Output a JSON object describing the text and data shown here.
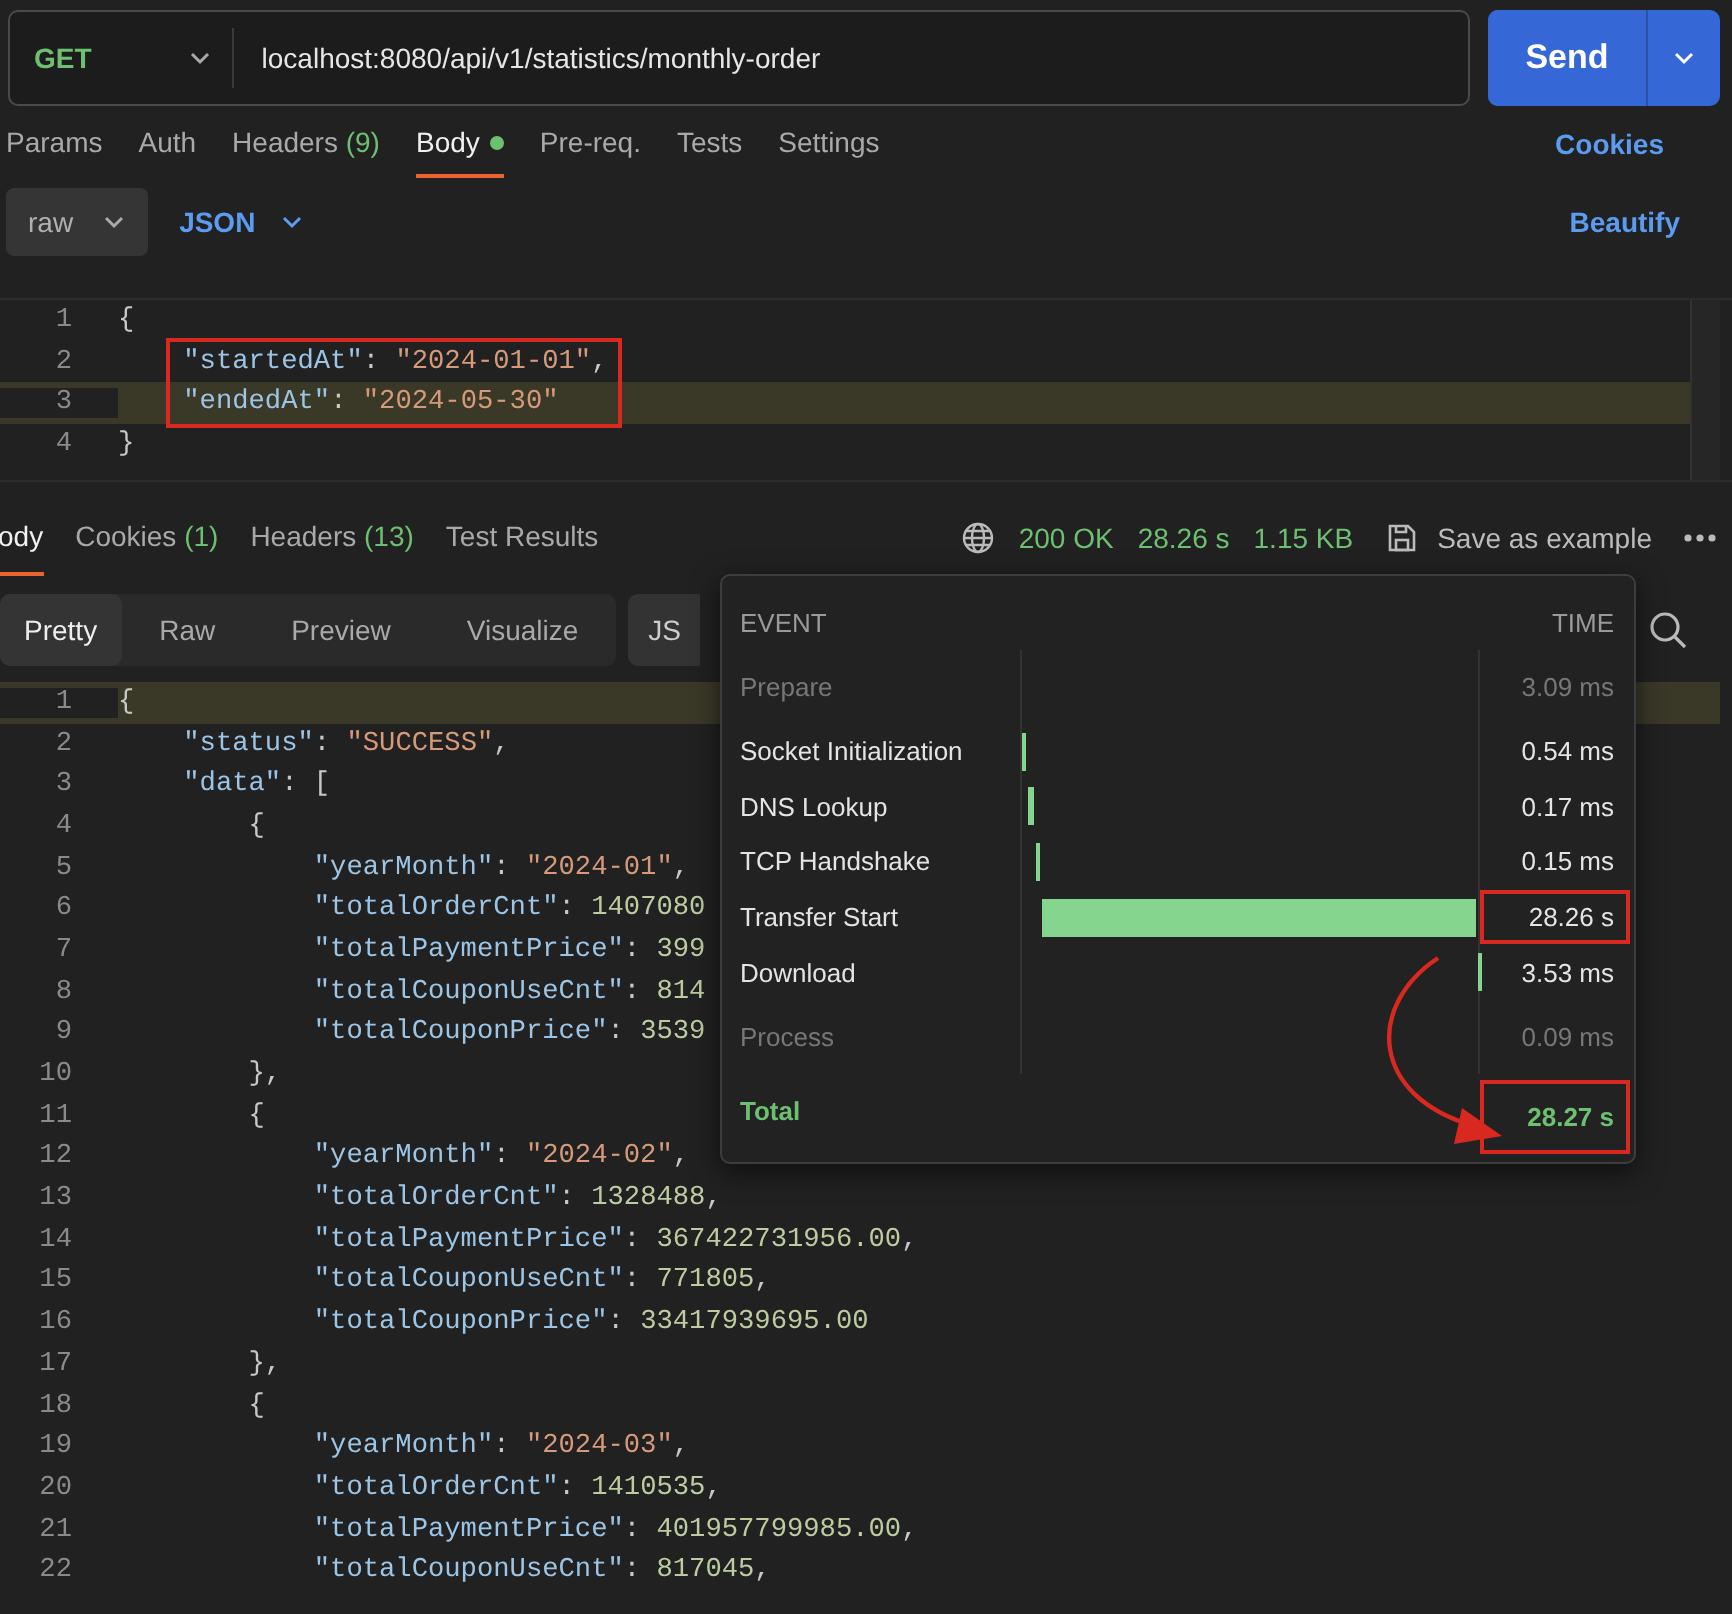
{
  "request": {
    "method": "GET",
    "url": "localhost:8080/api/v1/statistics/monthly-order",
    "send_label": "Send"
  },
  "request_tabs": [
    {
      "label": "Params",
      "selected": false
    },
    {
      "label": "Auth",
      "selected": false
    },
    {
      "label": "Headers",
      "count": "(9)",
      "selected": false
    },
    {
      "label": "Body",
      "selected": true,
      "dot": true
    },
    {
      "label": "Pre-req.",
      "selected": false
    },
    {
      "label": "Tests",
      "selected": false
    },
    {
      "label": "Settings",
      "selected": false
    }
  ],
  "cookies_link": "Cookies",
  "body_mode": {
    "type": "raw",
    "language": "JSON"
  },
  "beautify_link": "Beautify",
  "request_body": [
    {
      "number": "1",
      "current": false,
      "boxed": false,
      "tokens": [
        {
          "kind": "punct",
          "text": "{"
        }
      ]
    },
    {
      "number": "2",
      "current": false,
      "boxed": true,
      "tokens": [
        {
          "kind": "key",
          "text": "    \"startedAt\""
        },
        {
          "kind": "punct",
          "text": ": "
        },
        {
          "kind": "string",
          "text": "\"2024-01-01\""
        },
        {
          "kind": "punct",
          "text": ","
        }
      ]
    },
    {
      "number": "3",
      "current": true,
      "boxed": true,
      "tokens": [
        {
          "kind": "key",
          "text": "    \"endedAt\""
        },
        {
          "kind": "punct",
          "text": ": "
        },
        {
          "kind": "string",
          "text": "\"2024-05-30\""
        }
      ]
    },
    {
      "number": "4",
      "current": false,
      "boxed": false,
      "tokens": [
        {
          "kind": "punct",
          "text": "}"
        }
      ]
    }
  ],
  "response_tabs": [
    {
      "label": "ody",
      "selected": true
    },
    {
      "label": "Cookies",
      "count": "(1)",
      "selected": false
    },
    {
      "label": "Headers",
      "count": "(13)",
      "selected": false
    },
    {
      "label": "Test Results",
      "selected": false
    }
  ],
  "response_status": {
    "status": "200 OK",
    "time": "28.26 s",
    "size": "1.15 KB",
    "save_label": "Save as example"
  },
  "view_modes": [
    {
      "label": "Pretty",
      "selected": true
    },
    {
      "label": "Raw",
      "selected": false
    },
    {
      "label": "Preview",
      "selected": false
    },
    {
      "label": "Visualize",
      "selected": false
    }
  ],
  "format": "JS",
  "response_body": [
    {
      "number": "1",
      "current": true,
      "tokens": [
        {
          "kind": "punct",
          "text": "{"
        }
      ]
    },
    {
      "number": "2",
      "current": false,
      "tokens": [
        {
          "kind": "key",
          "text": "    \"status\""
        },
        {
          "kind": "punct",
          "text": ": "
        },
        {
          "kind": "string",
          "text": "\"SUCCESS\""
        },
        {
          "kind": "punct",
          "text": ","
        }
      ]
    },
    {
      "number": "3",
      "current": false,
      "tokens": [
        {
          "kind": "key",
          "text": "    \"data\""
        },
        {
          "kind": "punct",
          "text": ": ["
        }
      ]
    },
    {
      "number": "4",
      "current": false,
      "tokens": [
        {
          "kind": "punct",
          "text": "        {"
        }
      ]
    },
    {
      "number": "5",
      "current": false,
      "tokens": [
        {
          "kind": "key",
          "text": "            \"yearMonth\""
        },
        {
          "kind": "punct",
          "text": ": "
        },
        {
          "kind": "string",
          "text": "\"2024-01\""
        },
        {
          "kind": "punct",
          "text": ","
        }
      ]
    },
    {
      "number": "6",
      "current": false,
      "tokens": [
        {
          "kind": "key",
          "text": "            \"totalOrderCnt\""
        },
        {
          "kind": "punct",
          "text": ": "
        },
        {
          "kind": "number",
          "text": "1407080"
        }
      ]
    },
    {
      "number": "7",
      "current": false,
      "tokens": [
        {
          "kind": "key",
          "text": "            \"totalPaymentPrice\""
        },
        {
          "kind": "punct",
          "text": ": "
        },
        {
          "kind": "number",
          "text": "399"
        }
      ]
    },
    {
      "number": "8",
      "current": false,
      "tokens": [
        {
          "kind": "key",
          "text": "            \"totalCouponUseCnt\""
        },
        {
          "kind": "punct",
          "text": ": "
        },
        {
          "kind": "number",
          "text": "814"
        }
      ]
    },
    {
      "number": "9",
      "current": false,
      "tokens": [
        {
          "kind": "key",
          "text": "            \"totalCouponPrice\""
        },
        {
          "kind": "punct",
          "text": ": "
        },
        {
          "kind": "number",
          "text": "3539"
        }
      ]
    },
    {
      "number": "10",
      "current": false,
      "tokens": [
        {
          "kind": "punct",
          "text": "        },"
        }
      ]
    },
    {
      "number": "11",
      "current": false,
      "tokens": [
        {
          "kind": "punct",
          "text": "        {"
        }
      ]
    },
    {
      "number": "12",
      "current": false,
      "tokens": [
        {
          "kind": "key",
          "text": "            \"yearMonth\""
        },
        {
          "kind": "punct",
          "text": ": "
        },
        {
          "kind": "string",
          "text": "\"2024-02\""
        },
        {
          "kind": "punct",
          "text": ","
        }
      ]
    },
    {
      "number": "13",
      "current": false,
      "tokens": [
        {
          "kind": "key",
          "text": "            \"totalOrderCnt\""
        },
        {
          "kind": "punct",
          "text": ": "
        },
        {
          "kind": "number",
          "text": "1328488"
        },
        {
          "kind": "punct",
          "text": ","
        }
      ]
    },
    {
      "number": "14",
      "current": false,
      "tokens": [
        {
          "kind": "key",
          "text": "            \"totalPaymentPrice\""
        },
        {
          "kind": "punct",
          "text": ": "
        },
        {
          "kind": "number",
          "text": "367422731956.00"
        },
        {
          "kind": "punct",
          "text": ","
        }
      ]
    },
    {
      "number": "15",
      "current": false,
      "tokens": [
        {
          "kind": "key",
          "text": "            \"totalCouponUseCnt\""
        },
        {
          "kind": "punct",
          "text": ": "
        },
        {
          "kind": "number",
          "text": "771805"
        },
        {
          "kind": "punct",
          "text": ","
        }
      ]
    },
    {
      "number": "16",
      "current": false,
      "tokens": [
        {
          "kind": "key",
          "text": "            \"totalCouponPrice\""
        },
        {
          "kind": "punct",
          "text": ": "
        },
        {
          "kind": "number",
          "text": "33417939695.00"
        }
      ]
    },
    {
      "number": "17",
      "current": false,
      "tokens": [
        {
          "kind": "punct",
          "text": "        },"
        }
      ]
    },
    {
      "number": "18",
      "current": false,
      "tokens": [
        {
          "kind": "punct",
          "text": "        {"
        }
      ]
    },
    {
      "number": "19",
      "current": false,
      "tokens": [
        {
          "kind": "key",
          "text": "            \"yearMonth\""
        },
        {
          "kind": "punct",
          "text": ": "
        },
        {
          "kind": "string",
          "text": "\"2024-03\""
        },
        {
          "kind": "punct",
          "text": ","
        }
      ]
    },
    {
      "number": "20",
      "current": false,
      "tokens": [
        {
          "kind": "key",
          "text": "            \"totalOrderCnt\""
        },
        {
          "kind": "punct",
          "text": ": "
        },
        {
          "kind": "number",
          "text": "1410535"
        },
        {
          "kind": "punct",
          "text": ","
        }
      ]
    },
    {
      "number": "21",
      "current": false,
      "tokens": [
        {
          "kind": "key",
          "text": "            \"totalPaymentPrice\""
        },
        {
          "kind": "punct",
          "text": ": "
        },
        {
          "kind": "number",
          "text": "401957799985.00"
        },
        {
          "kind": "punct",
          "text": ","
        }
      ]
    },
    {
      "number": "22",
      "current": false,
      "tokens": [
        {
          "kind": "key",
          "text": "            \"totalCouponUseCnt\""
        },
        {
          "kind": "punct",
          "text": ": "
        },
        {
          "kind": "number",
          "text": "817045"
        },
        {
          "kind": "punct",
          "text": ","
        }
      ]
    }
  ],
  "timing_popup": {
    "event_header": "EVENT",
    "time_header": "TIME",
    "arrow": true,
    "rows": [
      {
        "kind": "phase",
        "name": "Prepare",
        "value": "3.09 ms"
      },
      {
        "kind": "bar",
        "name": "Socket Initialization",
        "value": "0.54 ms",
        "level": 0.01,
        "boxed": false
      },
      {
        "kind": "bar",
        "name": "DNS Lookup",
        "value": "0.17 ms",
        "level": 0.01,
        "boxed": false
      },
      {
        "kind": "bar",
        "name": "TCP Handshake",
        "value": "0.15 ms",
        "level": 0.01,
        "boxed": false
      },
      {
        "kind": "bar",
        "name": "Transfer Start",
        "value": "28.26 s",
        "level": 0.96,
        "boxed": true
      },
      {
        "kind": "bar",
        "name": "Download",
        "value": "3.53 ms",
        "level": 0.005,
        "boxed": false
      },
      {
        "kind": "phase",
        "name": "Process",
        "value": "0.09 ms"
      },
      {
        "kind": "total",
        "name": "Total",
        "value": "28.27 s",
        "boxed": true
      }
    ]
  }
}
